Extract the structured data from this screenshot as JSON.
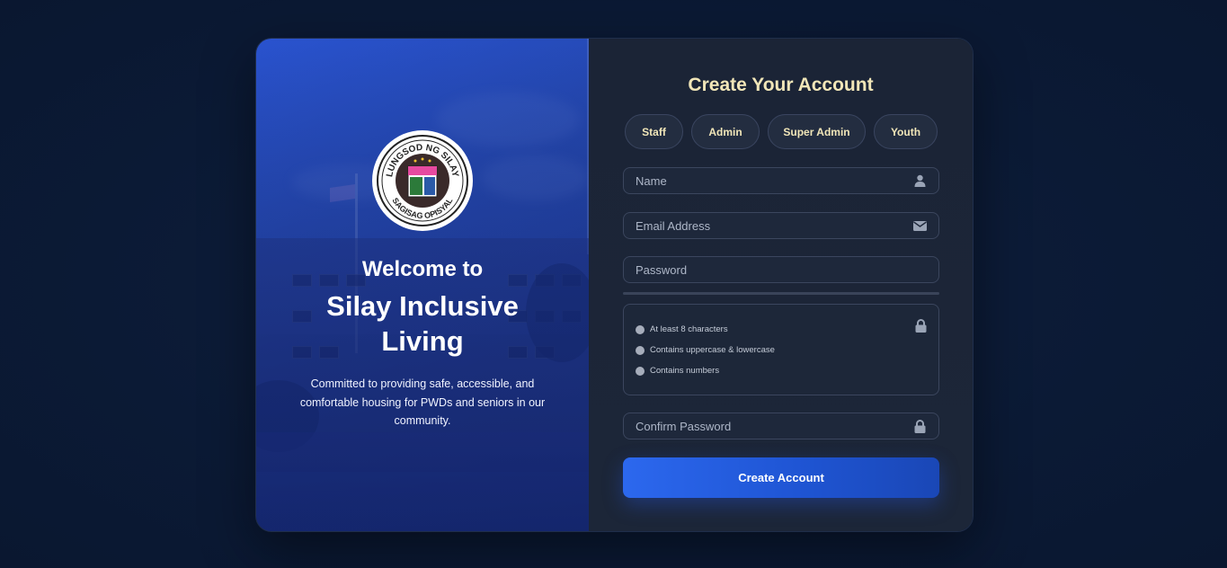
{
  "branding": {
    "seal_top_text": "LUNGSOD NG SILAY",
    "seal_bottom_text": "SAGISAG OPISYAL",
    "welcome": "Welcome to",
    "app_name": "Silay Inclusive Living",
    "tagline": "Committed to providing safe, accessible, and comfortable housing for PWDs and seniors in our community."
  },
  "form": {
    "title": "Create Your Account",
    "roles": [
      "Staff",
      "Admin",
      "Super Admin",
      "Youth"
    ],
    "name_placeholder": "Name",
    "email_placeholder": "Email Address",
    "password_placeholder": "Password",
    "confirm_placeholder": "Confirm Password",
    "requirements": [
      "At least 8 characters",
      "Contains uppercase & lowercase",
      "Contains numbers"
    ],
    "submit_label": "Create Account"
  },
  "icons": {
    "name": "user-icon",
    "email": "envelope-icon",
    "requirements": "lock-icon",
    "confirm": "lock-icon"
  },
  "colors": {
    "accent": "#2c68ee",
    "title": "#f1e6b8",
    "background": "#0b1a35"
  }
}
